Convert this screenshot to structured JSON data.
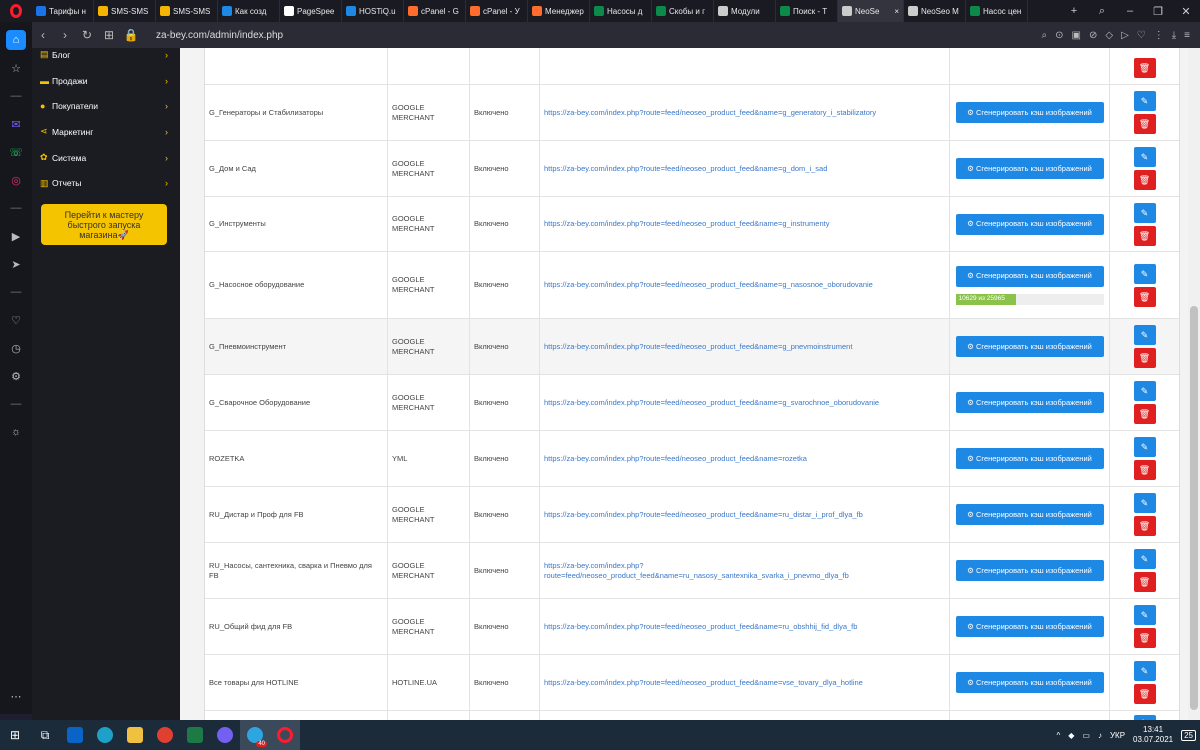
{
  "browser": {
    "tabs": [
      {
        "title": "Тарифы н",
        "color": "#1a73e8"
      },
      {
        "title": "SMS-SMS",
        "color": "#f5b400"
      },
      {
        "title": "SMS-SMS",
        "color": "#f5b400"
      },
      {
        "title": "Как созд",
        "color": "#1e88e5"
      },
      {
        "title": "PageSpee",
        "color": "#ffffff"
      },
      {
        "title": "HOSTiQ.u",
        "color": "#1e88e5"
      },
      {
        "title": "cPanel - G",
        "color": "#ff6c2c"
      },
      {
        "title": "cPanel - У",
        "color": "#ff6c2c"
      },
      {
        "title": "Менеджер",
        "color": "#ff6c2c"
      },
      {
        "title": "Насосы д",
        "color": "#0b8a4a"
      },
      {
        "title": "Скобы и г",
        "color": "#0b8a4a"
      },
      {
        "title": "Модули",
        "color": "#cccccc"
      },
      {
        "title": "Поиск - Т",
        "color": "#0b8a4a"
      },
      {
        "title": "NeoSe",
        "color": "#cccccc"
      },
      {
        "title": "NeoSeo M",
        "color": "#cccccc"
      },
      {
        "title": "Насос цен",
        "color": "#0b8a4a"
      }
    ],
    "active_tab": 13,
    "close_glyph": "×",
    "new_tab_glyph": "+",
    "url": "za-bey.com/admin/index.php"
  },
  "admin_menu": [
    {
      "label": "Блог",
      "icon": "book-icon"
    },
    {
      "label": "Продажи",
      "icon": "cart-icon"
    },
    {
      "label": "Покупатели",
      "icon": "user-icon"
    },
    {
      "label": "Маркетинг",
      "icon": "share-icon"
    },
    {
      "label": "Система",
      "icon": "gear-icon"
    },
    {
      "label": "Отчеты",
      "icon": "chart-icon"
    }
  ],
  "wizard_label": "Перейти к мастеру быстрого запуска магазина🚀",
  "gen_button_label": "⚙ Сгенерировать кэш изображений",
  "rows": [
    {
      "name": "G_Генераторы и Стабилизаторы",
      "type": "GOOGLE MERCHANT",
      "status": "Включено",
      "url": "https://za-bey.com/index.php?route=feed/neoseo_product_feed&name=g_generatory_i_stabilizatory"
    },
    {
      "name": "G_Дом и Сад",
      "type": "GOOGLE MERCHANT",
      "status": "Включено",
      "url": "https://za-bey.com/index.php?route=feed/neoseo_product_feed&name=g_dom_i_sad"
    },
    {
      "name": "G_Инструменты",
      "type": "GOOGLE MERCHANT",
      "status": "Включено",
      "url": "https://za-bey.com/index.php?route=feed/neoseo_product_feed&name=g_instrumenty"
    },
    {
      "name": "G_Насосное оборудование",
      "type": "GOOGLE MERCHANT",
      "status": "Включено",
      "url": "https://za-bey.com/index.php?route=feed/neoseo_product_feed&name=g_nasosnoe_oborudovanie",
      "progress_text": "10629 из 25965",
      "progress_fraction": 0.41
    },
    {
      "name": "G_Пневмоинструмент",
      "type": "GOOGLE MERCHANT",
      "status": "Включено",
      "url": "https://za-bey.com/index.php?route=feed/neoseo_product_feed&name=g_pnevmoinstrument"
    },
    {
      "name": "G_Сварочное Оборудование",
      "type": "GOOGLE MERCHANT",
      "status": "Включено",
      "url": "https://za-bey.com/index.php?route=feed/neoseo_product_feed&name=g_svarochnoe_oborudovanie"
    },
    {
      "name": "ROZETKA",
      "type": "YML",
      "status": "Включено",
      "url": "https://za-bey.com/index.php?route=feed/neoseo_product_feed&name=rozetka"
    },
    {
      "name": "RU_Дистар и Проф для FB",
      "type": "GOOGLE MERCHANT",
      "status": "Включено",
      "url": "https://za-bey.com/index.php?route=feed/neoseo_product_feed&name=ru_distar_i_prof_dlya_fb"
    },
    {
      "name": "RU_Насосы, сантехника, сварка и Пневмо для FB",
      "type": "GOOGLE MERCHANT",
      "status": "Включено",
      "url": "https://za-bey.com/index.php?route=feed/neoseo_product_feed&name=ru_nasosy_santexnika_svarka_i_pnevmo_dlya_fb"
    },
    {
      "name": "RU_Общий фид для FB",
      "type": "GOOGLE MERCHANT",
      "status": "Включено",
      "url": "https://za-bey.com/index.php?route=feed/neoseo_product_feed&name=ru_obshhij_fid_dlya_fb"
    },
    {
      "name": "Все товары для HOTLINE",
      "type": "HOTLINE.UA",
      "status": "Включено",
      "url": "https://za-bey.com/index.php?route=feed/neoseo_product_feed&name=vse_tovary_dlya_hotline"
    }
  ],
  "taskbar": {
    "lang": "УКР",
    "time": "13:41",
    "date": "03.07.2021",
    "notifications": "25",
    "telegram_badge": "40"
  }
}
